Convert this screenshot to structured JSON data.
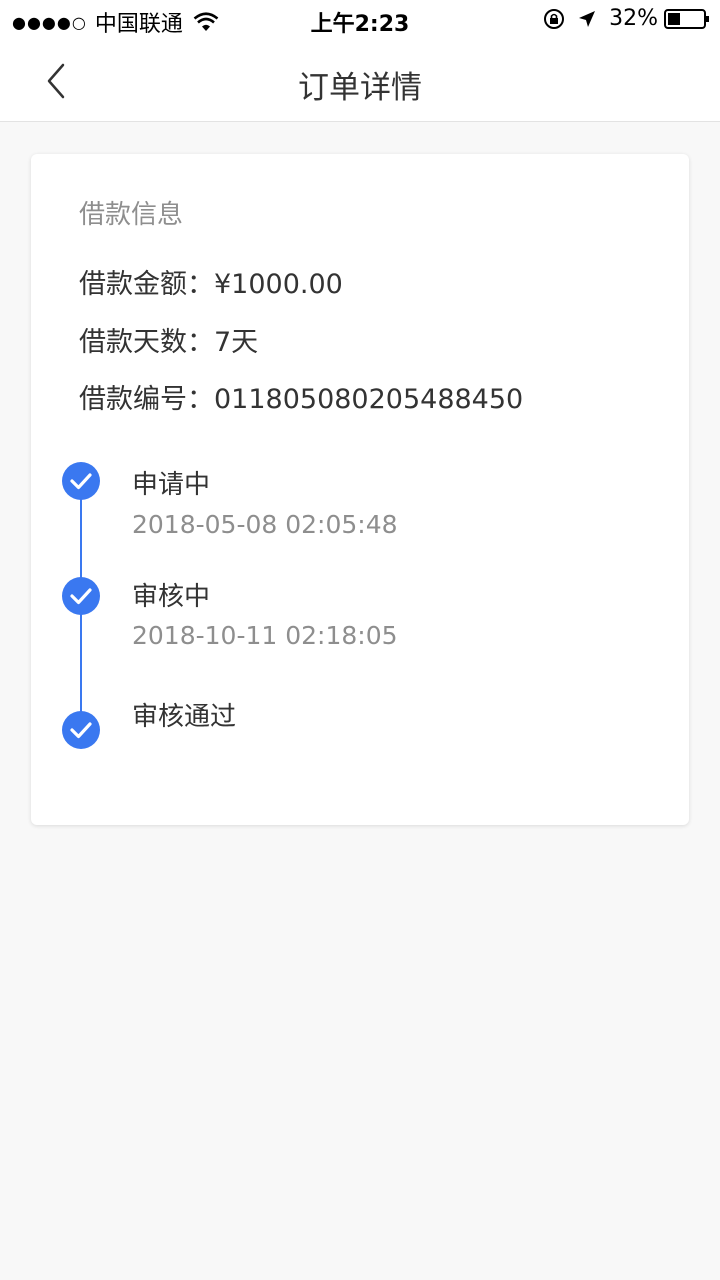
{
  "status_bar": {
    "signal": "●●●●○",
    "carrier": "中国联通",
    "time": "上午2:23",
    "battery": "32%"
  },
  "nav": {
    "title": "订单详情",
    "back_icon": "chevron-left-icon"
  },
  "loan_info": {
    "section_title": "借款信息",
    "amount": "借款金额：¥1000.00",
    "days": "借款天数：7天",
    "number": "借款编号：011805080205488450"
  },
  "timeline": {
    "accent_color": "#3a78f0",
    "steps": [
      {
        "label": "申请中",
        "time": "2018-05-08 02:05:48",
        "done": true
      },
      {
        "label": "审核中",
        "time": "2018-10-11 02:18:05",
        "done": true
      },
      {
        "label": "审核通过",
        "done": true
      }
    ]
  }
}
